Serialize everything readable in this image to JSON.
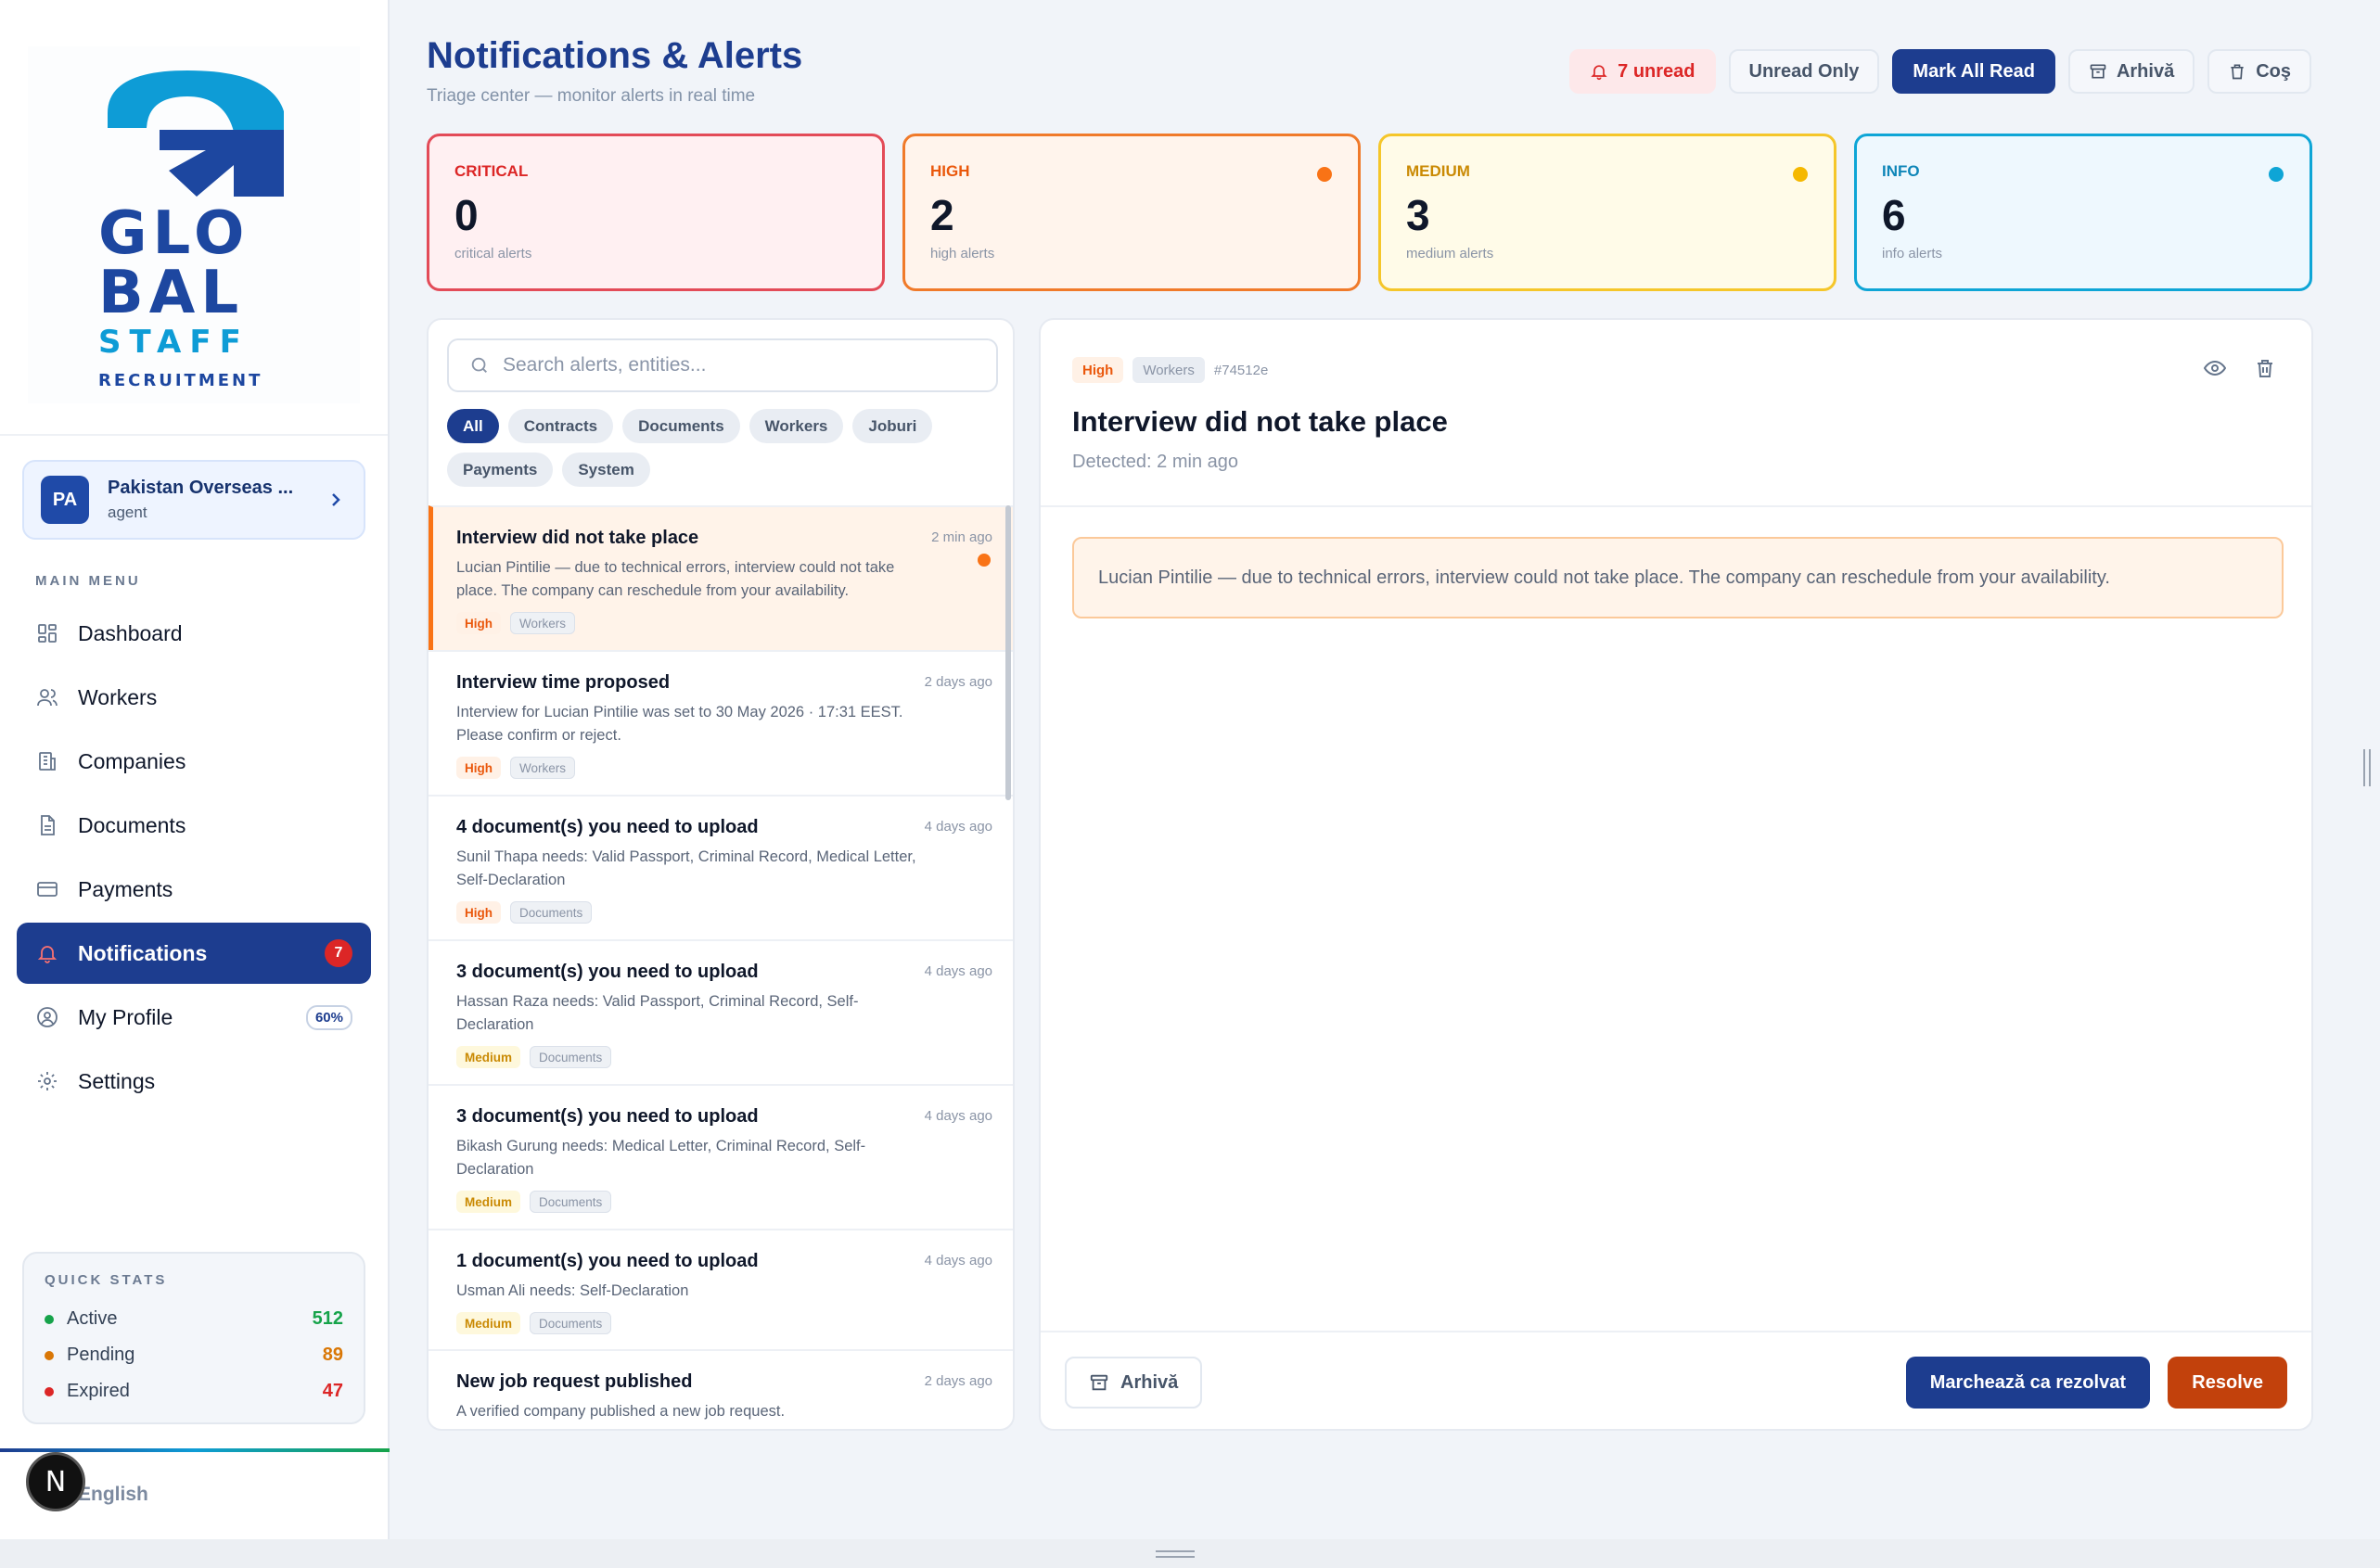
{
  "brand": {
    "logo_line1": "GLO",
    "logo_line2": "BAL",
    "logo_line3": "STAFF",
    "logo_line4": "RECRUITMENT",
    "primary": "#1d3d8f",
    "accent": "#0e9cd6"
  },
  "agency": {
    "initials": "PA",
    "name": "Pakistan Overseas ...",
    "role": "agent"
  },
  "sidebar": {
    "menu_title": "MAIN MENU",
    "items": [
      {
        "label": "Dashboard",
        "icon": "dashboard-icon"
      },
      {
        "label": "Workers",
        "icon": "users-icon"
      },
      {
        "label": "Companies",
        "icon": "building-icon"
      },
      {
        "label": "Documents",
        "icon": "document-icon"
      },
      {
        "label": "Payments",
        "icon": "credit-card-icon"
      },
      {
        "label": "Notifications",
        "icon": "bell-icon",
        "badge": "7",
        "active": true
      },
      {
        "label": "My Profile",
        "icon": "user-circle-icon",
        "badge": "60%"
      },
      {
        "label": "Settings",
        "icon": "gear-icon"
      }
    ],
    "quick_stats": {
      "title": "QUICK STATS",
      "rows": [
        {
          "label": "Active",
          "value": "512",
          "color": "#16a34a"
        },
        {
          "label": "Pending",
          "value": "89",
          "color": "#d97706"
        },
        {
          "label": "Expired",
          "value": "47",
          "color": "#dc2626"
        }
      ]
    },
    "language": "English",
    "n_badge": "N"
  },
  "header": {
    "title": "Notifications & Alerts",
    "subtitle": "Triage center — monitor alerts in real time",
    "unread_label": "7 unread",
    "unread_only_label": "Unread Only",
    "mark_all_label": "Mark All Read",
    "archive_label": "Arhivă",
    "trash_label": "Coş"
  },
  "stats": [
    {
      "label": "CRITICAL",
      "value": "0",
      "sub": "critical alerts",
      "color": "#dc2626",
      "bg": "#fff0f2",
      "border": "#e34b58"
    },
    {
      "label": "HIGH",
      "value": "2",
      "sub": "high alerts",
      "color": "#ea580c",
      "bg": "#fff4ec",
      "border": "#f07a2a",
      "dot": "#f97316"
    },
    {
      "label": "MEDIUM",
      "value": "3",
      "sub": "medium alerts",
      "color": "#ca8a04",
      "bg": "#fffbe8",
      "border": "#f5c62a",
      "dot": "#f5b800"
    },
    {
      "label": "INFO",
      "value": "6",
      "sub": "info alerts",
      "color": "#0e86b8",
      "bg": "#eef8fe",
      "border": "#0ea5d6",
      "dot": "#0ea5d6"
    }
  ],
  "list": {
    "search_placeholder": "Search alerts, entities...",
    "filters": [
      "All",
      "Contracts",
      "Documents",
      "Workers",
      "Joburi",
      "Payments",
      "System"
    ],
    "active_filter": "All",
    "items": [
      {
        "title": "Interview did not take place",
        "time": "2 min ago",
        "desc": "Lucian Pintilie — due to technical errors, interview could not take place. The company can reschedule from your availability.",
        "severity": "High",
        "category": "Workers",
        "unread": true,
        "selected": true
      },
      {
        "title": "Interview time proposed",
        "time": "2 days ago",
        "desc": "Interview for Lucian Pintilie was set to 30 May 2026 · 17:31 EEST. Please confirm or reject.",
        "severity": "High",
        "category": "Workers"
      },
      {
        "title": "4 document(s) you need to upload",
        "time": "4 days ago",
        "desc": "Sunil Thapa needs: Valid Passport, Criminal Record, Medical Letter, Self-Declaration",
        "severity": "High",
        "category": "Documents"
      },
      {
        "title": "3 document(s) you need to upload",
        "time": "4 days ago",
        "desc": "Hassan Raza needs: Valid Passport, Criminal Record, Self-Declaration",
        "severity": "Medium",
        "category": "Documents"
      },
      {
        "title": "3 document(s) you need to upload",
        "time": "4 days ago",
        "desc": "Bikash Gurung needs: Medical Letter, Criminal Record, Self-Declaration",
        "severity": "Medium",
        "category": "Documents"
      },
      {
        "title": "1 document(s) you need to upload",
        "time": "4 days ago",
        "desc": "Usman Ali needs: Self-Declaration",
        "severity": "Medium",
        "category": "Documents"
      },
      {
        "title": "New job request published",
        "time": "2 days ago",
        "desc": "A verified company published a new job request.",
        "severity": "",
        "category": ""
      }
    ]
  },
  "detail": {
    "severity": "High",
    "category": "Workers",
    "id": "#74512e",
    "title": "Interview did not take place",
    "detected": "Detected: 2 min ago",
    "message": "Lucian Pintilie — due to technical errors, interview could not take place. The company can reschedule from your availability.",
    "archive_label": "Arhivă",
    "mark_resolved_label": "Marchează ca rezolvat",
    "resolve_label": "Resolve"
  }
}
